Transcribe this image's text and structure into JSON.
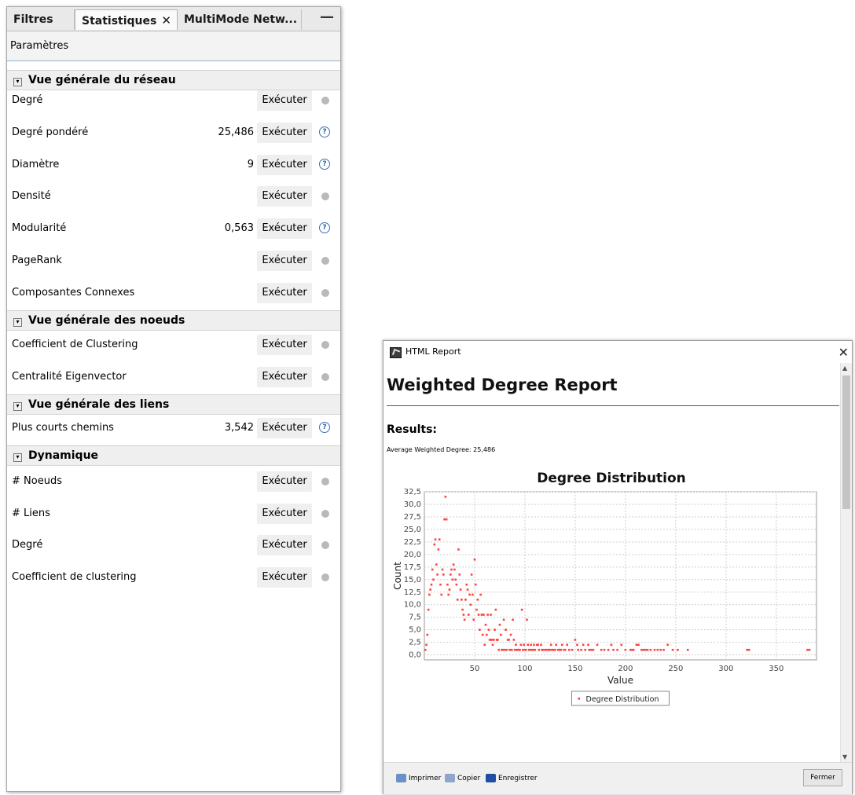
{
  "stats_panel": {
    "tabs": [
      {
        "label": "Filtres"
      },
      {
        "label": "Statistiques",
        "close": "✕"
      },
      {
        "label": "MultiMode Netw..."
      }
    ],
    "minimize": "—",
    "params_label": "Paramètres",
    "sections": [
      {
        "title": "Vue générale du réseau",
        "toggle": "▾"
      },
      {
        "title": "Vue générale des noeuds",
        "toggle": "▾"
      },
      {
        "title": "Vue générale des liens",
        "toggle": "▾"
      },
      {
        "title": "Dynamique",
        "toggle": "▾"
      }
    ],
    "rows": [
      {
        "label": "Degré",
        "value": "",
        "button": "Exécuter",
        "status": "not-run"
      },
      {
        "label": "Degré pondéré",
        "value": "25,486",
        "button": "Exécuter",
        "status": "help"
      },
      {
        "label": "Diamètre",
        "value": "9",
        "button": "Exécuter",
        "status": "help"
      },
      {
        "label": "Densité",
        "value": "",
        "button": "Exécuter",
        "status": "not-run"
      },
      {
        "label": "Modularité",
        "value": "0,563",
        "button": "Exécuter",
        "status": "help"
      },
      {
        "label": "PageRank",
        "value": "",
        "button": "Exécuter",
        "status": "not-run"
      },
      {
        "label": "Composantes Connexes",
        "value": "",
        "button": "Exécuter",
        "status": "not-run"
      },
      {
        "label": "Coefficient de Clustering",
        "value": "",
        "button": "Exécuter",
        "status": "not-run"
      },
      {
        "label": "Centralité Eigenvector",
        "value": "",
        "button": "Exécuter",
        "status": "not-run"
      },
      {
        "label": "Plus courts chemins",
        "value": "3,542",
        "button": "Exécuter",
        "status": "help"
      },
      {
        "label": "# Noeuds",
        "value": "",
        "button": "Exécuter",
        "status": "not-run"
      },
      {
        "label": "# Liens",
        "value": "",
        "button": "Exécuter",
        "status": "not-run"
      },
      {
        "label": "Degré",
        "value": "",
        "button": "Exécuter",
        "status": "not-run"
      },
      {
        "label": "Coefficient de clustering",
        "value": "",
        "button": "Exécuter",
        "status": "not-run"
      }
    ],
    "help_glyph": "?"
  },
  "report": {
    "window_title": "HTML Report",
    "close_glyph": "✕",
    "title": "Weighted Degree Report",
    "results_heading": "Results:",
    "average_text": "Average Weighted Degree: 25,486",
    "scroll_up": "▲",
    "scroll_down": "▼",
    "footer": {
      "print": "Imprimer",
      "copy": "Copier",
      "save": "Enregistrer",
      "close": "Fermer"
    },
    "icon_colors": {
      "print": "#6b8fc7",
      "copy": "#8da6c9",
      "save": "#1f4fa1"
    }
  },
  "chart_data": {
    "type": "scatter",
    "title": "Degree Distribution",
    "xlabel": "Value",
    "ylabel": "Count",
    "xlim": [
      0,
      390
    ],
    "ylim": [
      -1,
      32.5
    ],
    "xticks": [
      50,
      100,
      150,
      200,
      250,
      300,
      350
    ],
    "yticks": [
      0,
      2.5,
      5,
      7.5,
      10,
      12.5,
      15,
      17.5,
      20,
      22.5,
      25,
      27.5,
      30,
      32.5
    ],
    "ytick_labels": [
      "0,0",
      "2,5",
      "5,0",
      "7,5",
      "10,0",
      "12,5",
      "15,0",
      "17,5",
      "20,0",
      "22,5",
      "25,0",
      "27,5",
      "30,0",
      "32,5"
    ],
    "xtick_labels": [
      "50",
      "100",
      "150",
      "200",
      "250",
      "300",
      "350"
    ],
    "color": "#ff4040",
    "grid": true,
    "legend_placement": "bottom-center",
    "series": [
      {
        "name": "Degree Distribution",
        "points": [
          [
            1,
            1
          ],
          [
            2,
            2
          ],
          [
            3,
            4
          ],
          [
            4,
            9
          ],
          [
            5,
            12
          ],
          [
            6,
            13
          ],
          [
            7,
            14
          ],
          [
            8,
            17
          ],
          [
            9,
            15
          ],
          [
            10,
            22
          ],
          [
            11,
            23
          ],
          [
            12,
            18
          ],
          [
            13,
            16
          ],
          [
            14,
            21
          ],
          [
            15,
            23
          ],
          [
            16,
            14
          ],
          [
            17,
            12
          ],
          [
            18,
            17
          ],
          [
            19,
            16
          ],
          [
            20,
            27
          ],
          [
            21,
            31.5
          ],
          [
            22,
            27
          ],
          [
            23,
            14
          ],
          [
            24,
            12
          ],
          [
            25,
            13
          ],
          [
            26,
            16
          ],
          [
            27,
            17
          ],
          [
            28,
            15
          ],
          [
            29,
            18
          ],
          [
            30,
            17
          ],
          [
            31,
            15
          ],
          [
            32,
            14
          ],
          [
            33,
            11
          ],
          [
            34,
            21
          ],
          [
            35,
            16
          ],
          [
            36,
            13
          ],
          [
            37,
            11
          ],
          [
            38,
            9
          ],
          [
            39,
            8
          ],
          [
            40,
            7
          ],
          [
            41,
            11
          ],
          [
            42,
            14
          ],
          [
            43,
            13
          ],
          [
            44,
            8
          ],
          [
            45,
            12
          ],
          [
            46,
            10
          ],
          [
            47,
            16
          ],
          [
            48,
            12
          ],
          [
            49,
            7
          ],
          [
            50,
            19
          ],
          [
            51,
            14
          ],
          [
            52,
            9
          ],
          [
            53,
            11
          ],
          [
            54,
            8
          ],
          [
            55,
            5
          ],
          [
            56,
            12
          ],
          [
            57,
            8
          ],
          [
            58,
            4
          ],
          [
            59,
            8
          ],
          [
            60,
            2
          ],
          [
            61,
            6
          ],
          [
            62,
            4
          ],
          [
            63,
            8
          ],
          [
            64,
            5
          ],
          [
            65,
            3
          ],
          [
            66,
            8
          ],
          [
            67,
            3
          ],
          [
            68,
            2
          ],
          [
            69,
            3
          ],
          [
            70,
            5
          ],
          [
            71,
            9
          ],
          [
            72,
            3
          ],
          [
            73,
            3
          ],
          [
            74,
            1
          ],
          [
            75,
            6
          ],
          [
            76,
            4
          ],
          [
            77,
            1
          ],
          [
            78,
            1
          ],
          [
            79,
            7
          ],
          [
            80,
            1
          ],
          [
            81,
            5
          ],
          [
            82,
            1
          ],
          [
            83,
            3
          ],
          [
            84,
            3
          ],
          [
            85,
            1
          ],
          [
            86,
            4
          ],
          [
            87,
            1
          ],
          [
            88,
            7
          ],
          [
            89,
            3
          ],
          [
            90,
            1
          ],
          [
            91,
            2
          ],
          [
            92,
            1
          ],
          [
            93,
            1
          ],
          [
            94,
            1
          ],
          [
            95,
            1
          ],
          [
            96,
            2
          ],
          [
            97,
            9
          ],
          [
            98,
            1
          ],
          [
            99,
            2
          ],
          [
            100,
            1
          ],
          [
            101,
            1
          ],
          [
            102,
            7
          ],
          [
            103,
            2
          ],
          [
            104,
            1
          ],
          [
            105,
            1
          ],
          [
            106,
            2
          ],
          [
            107,
            1
          ],
          [
            108,
            1
          ],
          [
            109,
            2
          ],
          [
            110,
            1
          ],
          [
            112,
            2
          ],
          [
            113,
            2
          ],
          [
            114,
            1
          ],
          [
            116,
            2
          ],
          [
            117,
            1
          ],
          [
            118,
            1
          ],
          [
            120,
            1
          ],
          [
            121,
            1
          ],
          [
            123,
            1
          ],
          [
            124,
            1
          ],
          [
            125,
            1
          ],
          [
            126,
            2
          ],
          [
            127,
            1
          ],
          [
            128,
            1
          ],
          [
            130,
            1
          ],
          [
            131,
            2
          ],
          [
            133,
            1
          ],
          [
            134,
            1
          ],
          [
            135,
            1
          ],
          [
            136,
            1
          ],
          [
            137,
            2
          ],
          [
            139,
            1
          ],
          [
            140,
            1
          ],
          [
            142,
            2
          ],
          [
            144,
            1
          ],
          [
            147,
            1
          ],
          [
            150,
            3
          ],
          [
            152,
            2
          ],
          [
            153,
            1
          ],
          [
            156,
            1
          ],
          [
            158,
            2
          ],
          [
            160,
            1
          ],
          [
            163,
            2
          ],
          [
            164,
            1
          ],
          [
            166,
            1
          ],
          [
            168,
            1
          ],
          [
            172,
            2
          ],
          [
            176,
            1
          ],
          [
            179,
            1
          ],
          [
            183,
            1
          ],
          [
            186,
            2
          ],
          [
            188,
            1
          ],
          [
            192,
            1
          ],
          [
            196,
            2
          ],
          [
            200,
            1
          ],
          [
            205,
            1
          ],
          [
            207,
            1
          ],
          [
            208,
            1
          ],
          [
            211,
            2
          ],
          [
            213,
            2
          ],
          [
            216,
            1
          ],
          [
            218,
            1
          ],
          [
            220,
            1
          ],
          [
            222,
            1
          ],
          [
            225,
            1
          ],
          [
            229,
            1
          ],
          [
            232,
            1
          ],
          [
            235,
            1
          ],
          [
            238,
            1
          ],
          [
            242,
            2
          ],
          [
            247,
            1
          ],
          [
            252,
            1
          ],
          [
            262,
            1
          ],
          [
            321,
            1
          ],
          [
            323,
            1
          ],
          [
            381,
            1
          ],
          [
            383,
            1
          ]
        ]
      }
    ],
    "legend": [
      "Degree Distribution"
    ]
  }
}
